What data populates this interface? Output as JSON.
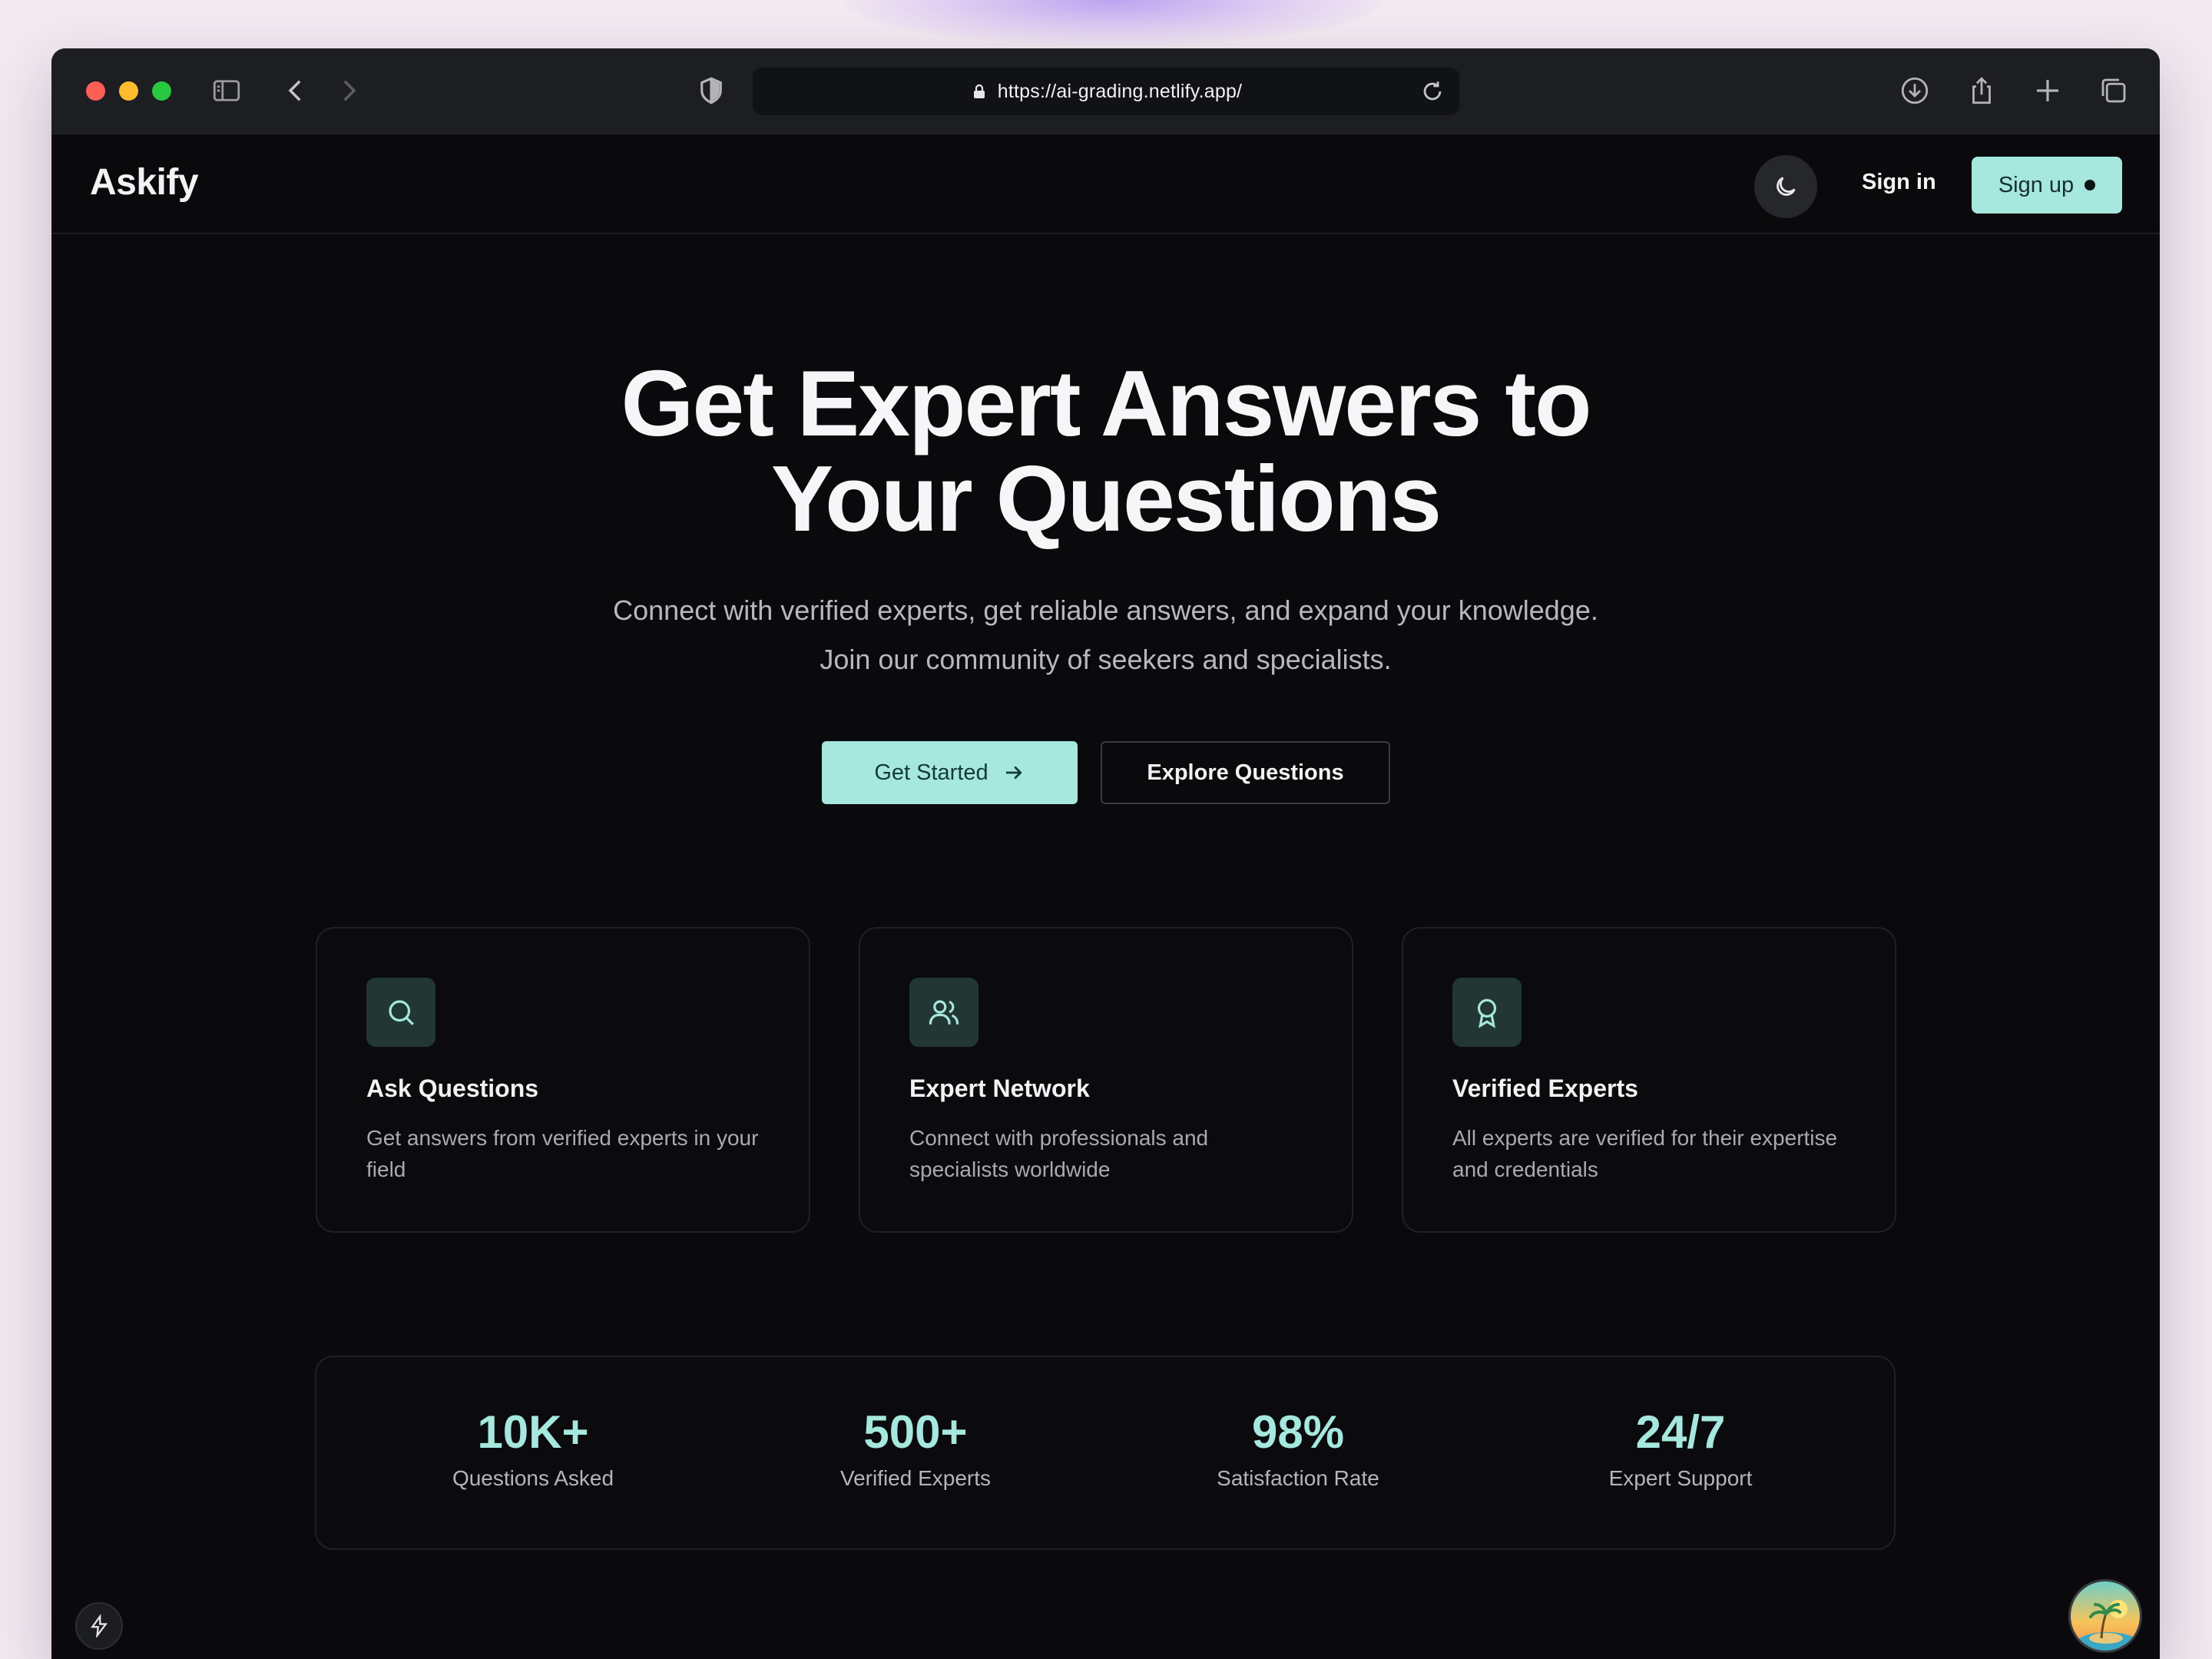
{
  "browser": {
    "url": "https://ai-grading.netlify.app/"
  },
  "nav": {
    "logo": "Askify",
    "sign_in": "Sign in",
    "sign_up": "Sign up"
  },
  "hero": {
    "title_line1": "Get Expert Answers to",
    "title_line2": "Your Questions",
    "subtitle_line1": "Connect with verified experts, get reliable answers, and expand your knowledge.",
    "subtitle_line2": "Join our community of seekers and specialists.",
    "primary_cta": "Get Started",
    "secondary_cta": "Explore Questions"
  },
  "features": [
    {
      "icon": "search-icon",
      "title": "Ask Questions",
      "description": "Get answers from verified experts in your field"
    },
    {
      "icon": "users-icon",
      "title": "Expert Network",
      "description": "Connect with professionals and specialists worldwide"
    },
    {
      "icon": "award-icon",
      "title": "Verified Experts",
      "description": "All experts are verified for their expertise and credentials"
    }
  ],
  "stats": [
    {
      "value": "10K+",
      "label": "Questions Asked"
    },
    {
      "value": "500+",
      "label": "Verified Experts"
    },
    {
      "value": "98%",
      "label": "Satisfaction Rate"
    },
    {
      "value": "24/7",
      "label": "Expert Support"
    }
  ],
  "colors": {
    "accent": "#a6e7de",
    "background": "#0a0a0c",
    "icon_box": "#223733"
  }
}
